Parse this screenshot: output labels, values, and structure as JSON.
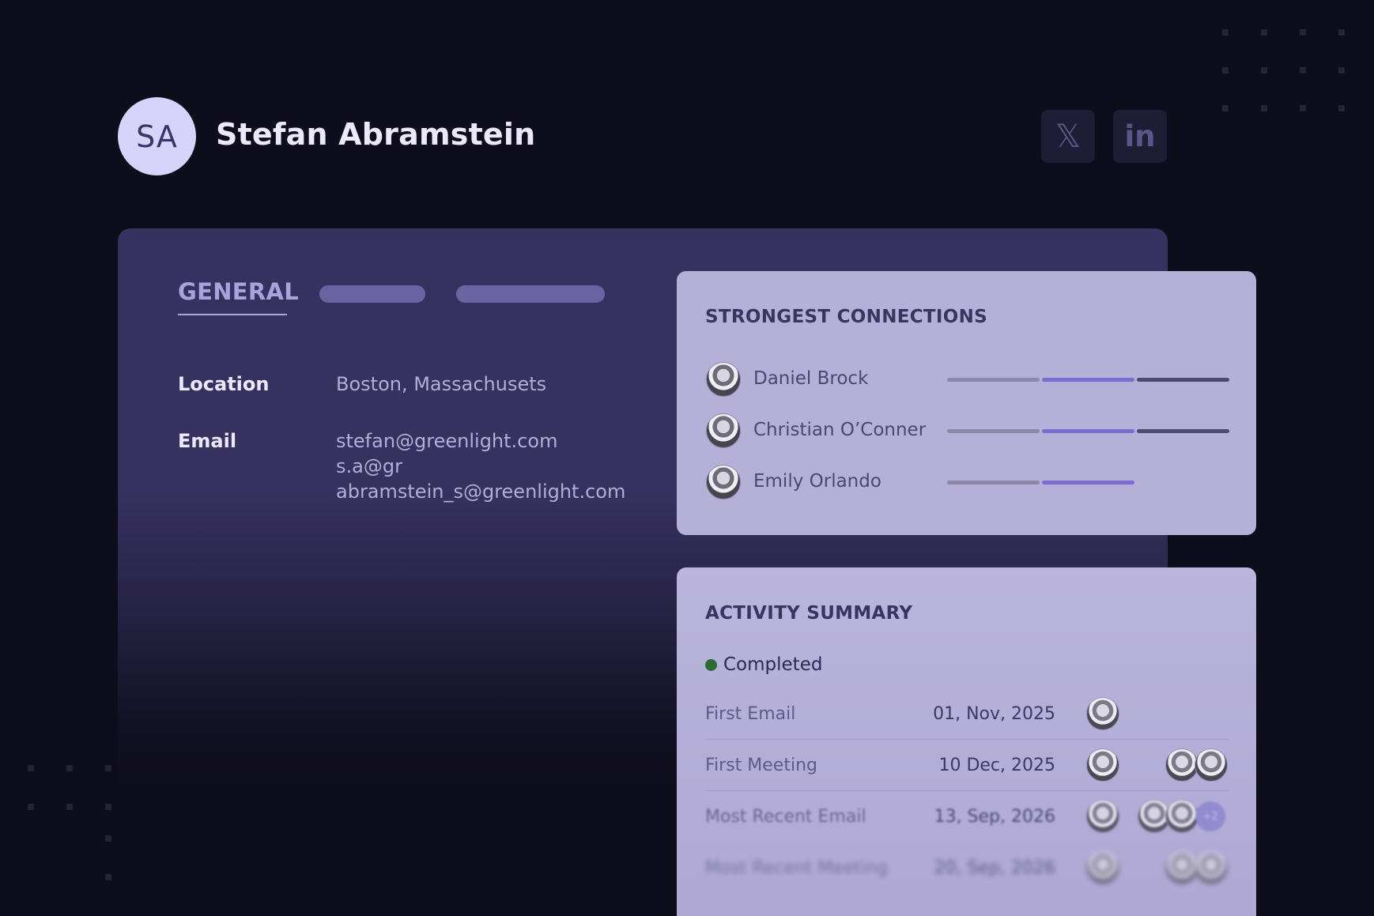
{
  "profile": {
    "initials": "SA",
    "name": "Stefan Abramstein"
  },
  "social": {
    "x_icon": "x-logo-icon",
    "x_glyph": "𝕏",
    "linkedin_icon": "linkedin-icon",
    "linkedin_glyph": "in"
  },
  "tabs": {
    "active_label": "GENERAL"
  },
  "general": {
    "location_label": "Location",
    "location_value": "Boston, Massachusets",
    "email_label": "Email",
    "emails": [
      "stefan@greenlight.com",
      "s.a@gr",
      "abramstein_s@greenlight.com"
    ]
  },
  "connections": {
    "title": "STRONGEST CONNECTIONS",
    "people": [
      {
        "name": "Daniel Brock",
        "strength_segments": 3
      },
      {
        "name": "Christian O’Conner",
        "strength_segments": 3
      },
      {
        "name": "Emily Orlando",
        "strength_segments": 2
      }
    ]
  },
  "activity": {
    "title": "ACTIVITY SUMMARY",
    "status": "Completed",
    "rows": [
      {
        "label": "First Email",
        "date": "01, Nov, 2025",
        "extra_count": ""
      },
      {
        "label": "First Meeting",
        "date": "10 Dec, 2025",
        "extra_count": ""
      },
      {
        "label": "Most Recent Email",
        "date": "13, Sep, 2026",
        "extra_count": "+2"
      },
      {
        "label": "Most Recent Meeting",
        "date": "20, Sep, 2026",
        "extra_count": ""
      }
    ]
  },
  "colors": {
    "background": "#0e0d1b",
    "card": "#37315f",
    "accent": "#8b7fd8",
    "status_completed": "#2c6b35"
  }
}
